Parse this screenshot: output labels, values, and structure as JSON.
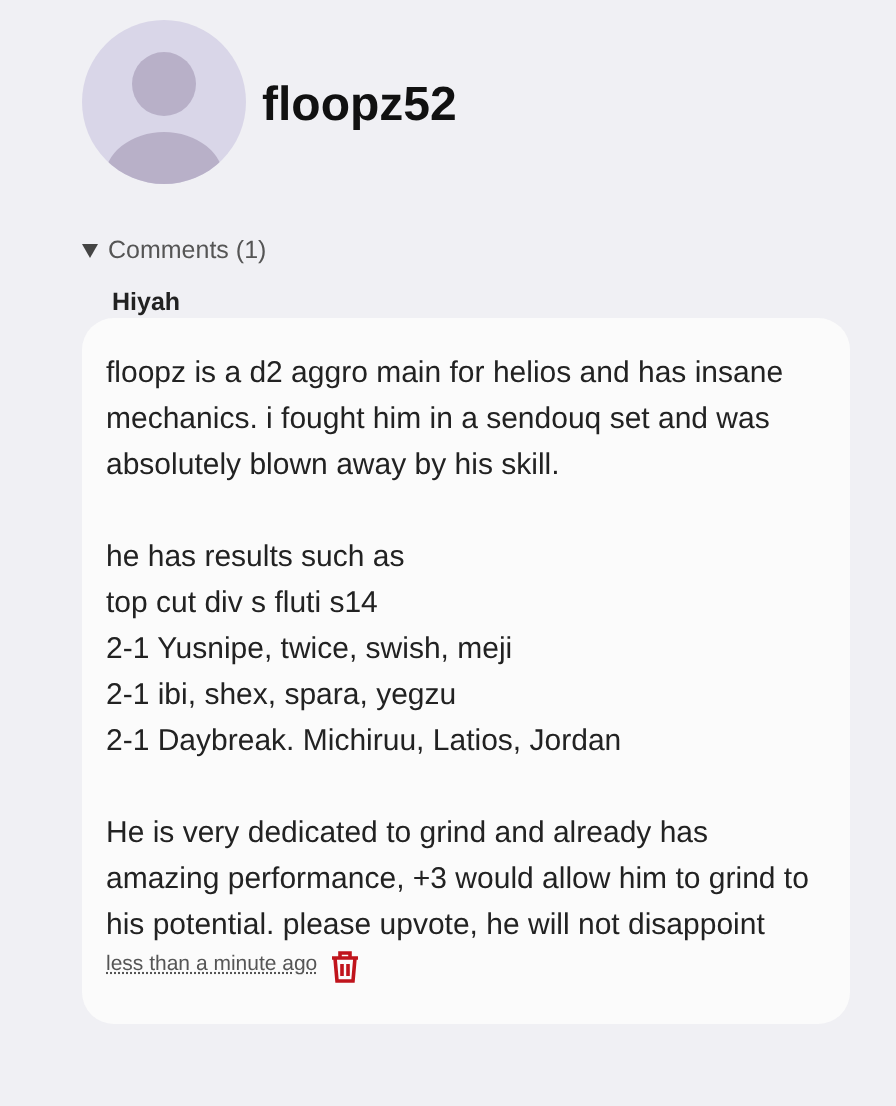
{
  "profile": {
    "username": "floopz52"
  },
  "comments_section": {
    "label": "Comments (1)",
    "expanded": true,
    "comments": [
      {
        "author": "Hiyah",
        "paragraphs": [
          "floopz is a d2 aggro main for helios and has insane mechanics. i fought him in a sendouq set and was absolutely blown away by his skill.",
          "he has results such as\ntop cut div s fluti s14\n2-1 Yusnipe, twice,  swish, meji\n2-1 ibi, shex, spara, yegzu\n2-1 Daybreak. Michiruu, Latios, Jordan",
          "He is very dedicated to grind and already has amazing performance, +3 would allow him to grind to his potential. please upvote, he will not disappoint"
        ],
        "time": "less than a minute ago"
      }
    ]
  }
}
